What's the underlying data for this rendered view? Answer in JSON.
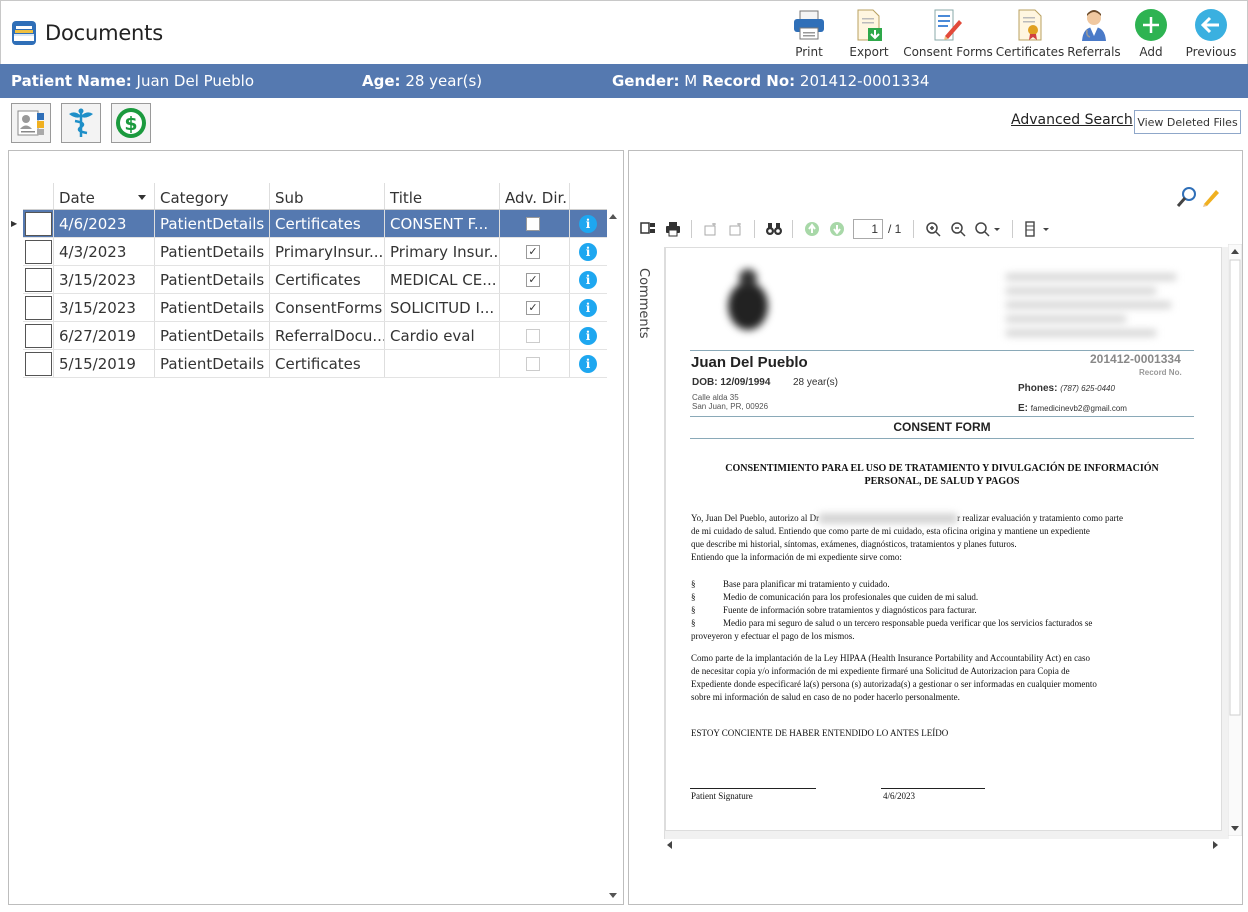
{
  "app": {
    "title": "Documents"
  },
  "toolbar": [
    {
      "label": "Print",
      "icon": "printer-icon"
    },
    {
      "label": "Export",
      "icon": "export-icon"
    },
    {
      "label": "Consent Forms",
      "icon": "consent-forms-icon"
    },
    {
      "label": "Certificates",
      "icon": "certificate-icon"
    },
    {
      "label": "Referrals",
      "icon": "referrals-icon"
    },
    {
      "label": "Add",
      "icon": "add-icon"
    },
    {
      "label": "Previous",
      "icon": "back-arrow-icon"
    }
  ],
  "patient": {
    "name_label": "Patient Name:",
    "name": "Juan Del Pueblo",
    "age_label": "Age:",
    "age": "28 year(s)",
    "gender_label": "Gender:",
    "gender": "M",
    "record_label": "Record No:",
    "record": "201412-0001334"
  },
  "actions": {
    "advanced_search": "Advanced Search",
    "view_deleted": "View Deleted Files"
  },
  "grid": {
    "columns": [
      "Date",
      "Category",
      "Sub",
      "Title",
      "Adv. Dir."
    ],
    "rows": [
      {
        "date": "4/6/2023",
        "category": "PatientDetails",
        "sub": "Certificates",
        "title": "CONSENT F...",
        "adv_dir": false,
        "selected": true
      },
      {
        "date": "4/3/2023",
        "category": "PatientDetails",
        "sub": "PrimaryInsur...",
        "title": "Primary Insur...",
        "adv_dir": true,
        "selected": false
      },
      {
        "date": "3/15/2023",
        "category": "PatientDetails",
        "sub": "Certificates",
        "title": "MEDICAL CE...",
        "adv_dir": true,
        "selected": false
      },
      {
        "date": "3/15/2023",
        "category": "PatientDetails",
        "sub": "ConsentForms",
        "title": "SOLICITUD I...",
        "adv_dir": true,
        "selected": false
      },
      {
        "date": "6/27/2019",
        "category": "PatientDetails",
        "sub": "ReferralDocu...",
        "title": "Cardio eval",
        "adv_dir": false,
        "selected": false
      },
      {
        "date": "5/15/2019",
        "category": "PatientDetails",
        "sub": "Certificates",
        "title": "",
        "adv_dir": false,
        "selected": false
      }
    ]
  },
  "viewer": {
    "page_current": "1",
    "page_total": "/ 1",
    "comments_label": "Comments"
  },
  "document": {
    "patient_name": "Juan Del Pueblo",
    "record_no": "201412-0001334",
    "record_no_label": "Record No.",
    "dob": "DOB: 12/09/1994",
    "age": "28 year(s)",
    "address_1": "Calle alda 35",
    "address_2": "San Juan, PR, 00926",
    "phones_label": "Phones:",
    "phones": "(787) 625-0440",
    "email_label": "E:",
    "email": "famedicinevb2@gmail.com",
    "section_title": "CONSENT FORM",
    "heading_1": "CONSENTIMIENTO PARA EL USO DE TRATAMIENTO Y DIVULGACIÓN DE INFORMACIÓN",
    "heading_2": "PERSONAL, DE SALUD Y PAGOS",
    "para_1a": "Yo, Juan Del Pueblo, autorizo al Dr",
    "para_1b": "r realizar evaluación y tratamiento como parte",
    "para_1c": "de mi cuidado de salud.  Entiendo que como parte de mi cuidado, esta oficina origina y mantiene un expediente",
    "para_1d": "que describe mi historial, síntomas, exámenes, diagnósticos, tratamientos y planes futuros.",
    "para_1e": "Entiendo que la información de mi expediente sirve como:",
    "bullet_symbol": "§",
    "bullets": [
      "Base para planificar mi tratamiento y cuidado.",
      "Medio de comunicación para los profesionales que cuiden de mi salud.",
      "Fuente de información sobre tratamientos y diagnósticos para facturar.",
      "Medio para mi seguro de salud o un tercero responsable pueda verificar que los servicios facturados se"
    ],
    "bullet_cont": "proveyeron y efectuar el pago de los mismos.",
    "para_2a": "Como parte de la implantación de la Ley HIPAA (Health Insurance Portability and Accountability Act) en caso",
    "para_2b": "de necesitar copia y/o información de mi expediente firmaré una Solicitud de Autorizacion para Copia de",
    "para_2c": "Expediente donde especificaré la(s) persona (s) autorizada(s) a gestionar o ser informadas en cualquier momento",
    "para_2d": "sobre mi información de salud en caso de no poder hacerlo personalmente.",
    "statement": "ESTOY CONCIENTE DE HABER ENTENDIDO LO ANTES LEÍDO",
    "signature_label": "Patient Signature",
    "signature_date": "4/6/2023"
  }
}
